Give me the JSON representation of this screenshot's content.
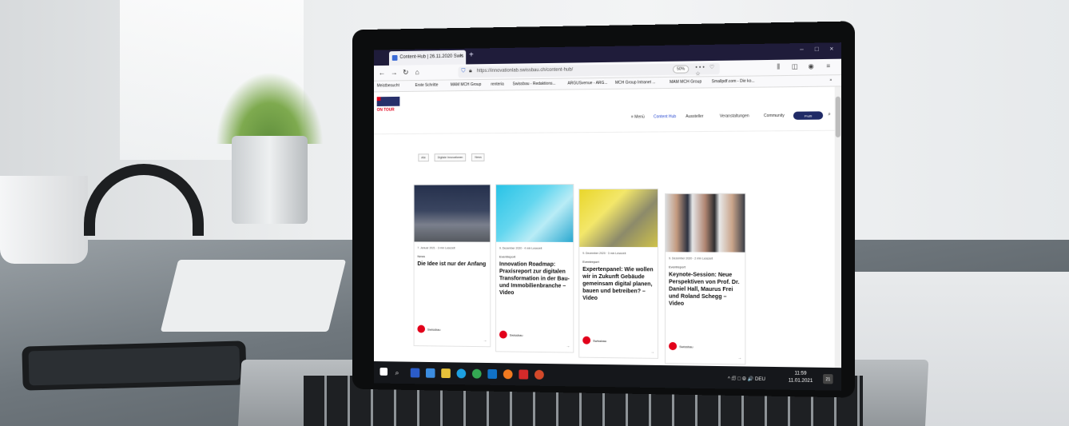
{
  "browser": {
    "tab_title": "Content-Hub | 26.11.2020 Swis",
    "tab_close": "×",
    "new_tab": "+",
    "window_controls": [
      "–",
      "□",
      "×"
    ],
    "url": "https://innovationlab.swissbau.ch/content-hub/",
    "zoom": "50%",
    "url_actions": "••• ♡ ☆",
    "bookmarks": [
      "Meistbesucht",
      "Erste Schritte",
      "MAM MCH Group",
      "renteria",
      "Swissbau - Redaktions...",
      "ARGUSvenue - ARG...",
      "MCH Group Intranet ...",
      "MAM MCH Group",
      "Smallpdf.com - Die ko..."
    ]
  },
  "site": {
    "logo_text": "ON TOUR",
    "nav": [
      "≡ Menü",
      "Content Hub",
      "Aussteller",
      "Veranstaltungen",
      "Community"
    ],
    "profile_button": "Profil",
    "filters": [
      "Alle",
      "Digitale Innovationen",
      "News"
    ]
  },
  "cards": [
    {
      "meta": "7. Januar 2021 · 3 min Lesezeit",
      "category": "News",
      "title": "Die Idee ist nur der Anfang",
      "brand": "Swissbau",
      "arrow": "→"
    },
    {
      "meta": "9. Dezember 2020 · 4 min Lesezeit",
      "category": "Eventreport",
      "title": "Innovation Roadmap: Praxisreport zur digitalen Transformation in der Bau- und Immobilienbranche – Video",
      "brand": "Swissbau",
      "arrow": "→"
    },
    {
      "meta": "9. Dezember 2020 · 3 min Lesezeit",
      "category": "Eventreport",
      "title": "Expertenpanel: Wie wollen wir in Zukunft Gebäude gemeinsam digital planen, bauen und betreiben? – Video",
      "brand": "Swissbau",
      "arrow": "→"
    },
    {
      "meta": "9. Dezember 2020 · 2 min Lesezeit",
      "category": "Eventreport",
      "title": "Keynote-Session: Neue Perspektiven von Prof. Dr. Daniel Hall, Maurus Frei und Roland Schegg – Video",
      "brand": "Swissbau",
      "arrow": "→"
    }
  ],
  "taskbar": {
    "tray": "^ 🗊 ◻ ⦾ 🔊 DEU",
    "time": "11:59",
    "date": "11.01.2021",
    "notifications": "21"
  }
}
